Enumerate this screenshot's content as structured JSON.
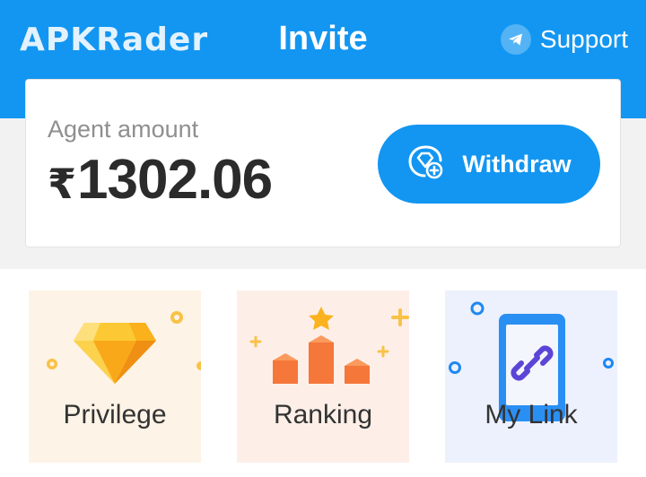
{
  "header": {
    "logo_text": "APKRader",
    "title": "Invite",
    "support_label": "Support",
    "support_icon": "telegram-icon"
  },
  "agent_card": {
    "label": "Agent amount",
    "currency": "₹",
    "amount": "1302.06",
    "withdraw_label": "Withdraw",
    "withdraw_icon": "diamond-plus-icon"
  },
  "tiles": [
    {
      "label": "Privilege",
      "icon": "diamond-icon",
      "bg": "#fdf3e6"
    },
    {
      "label": "Ranking",
      "icon": "ranking-podium-icon",
      "bg": "#fdefe8"
    },
    {
      "label": "My Link",
      "icon": "phone-link-icon",
      "bg": "#ecf1fd"
    }
  ],
  "colors": {
    "brand_blue": "#1296f1",
    "white": "#ffffff",
    "text_dark": "#2b2b2b",
    "text_muted": "#8f8f8f"
  }
}
